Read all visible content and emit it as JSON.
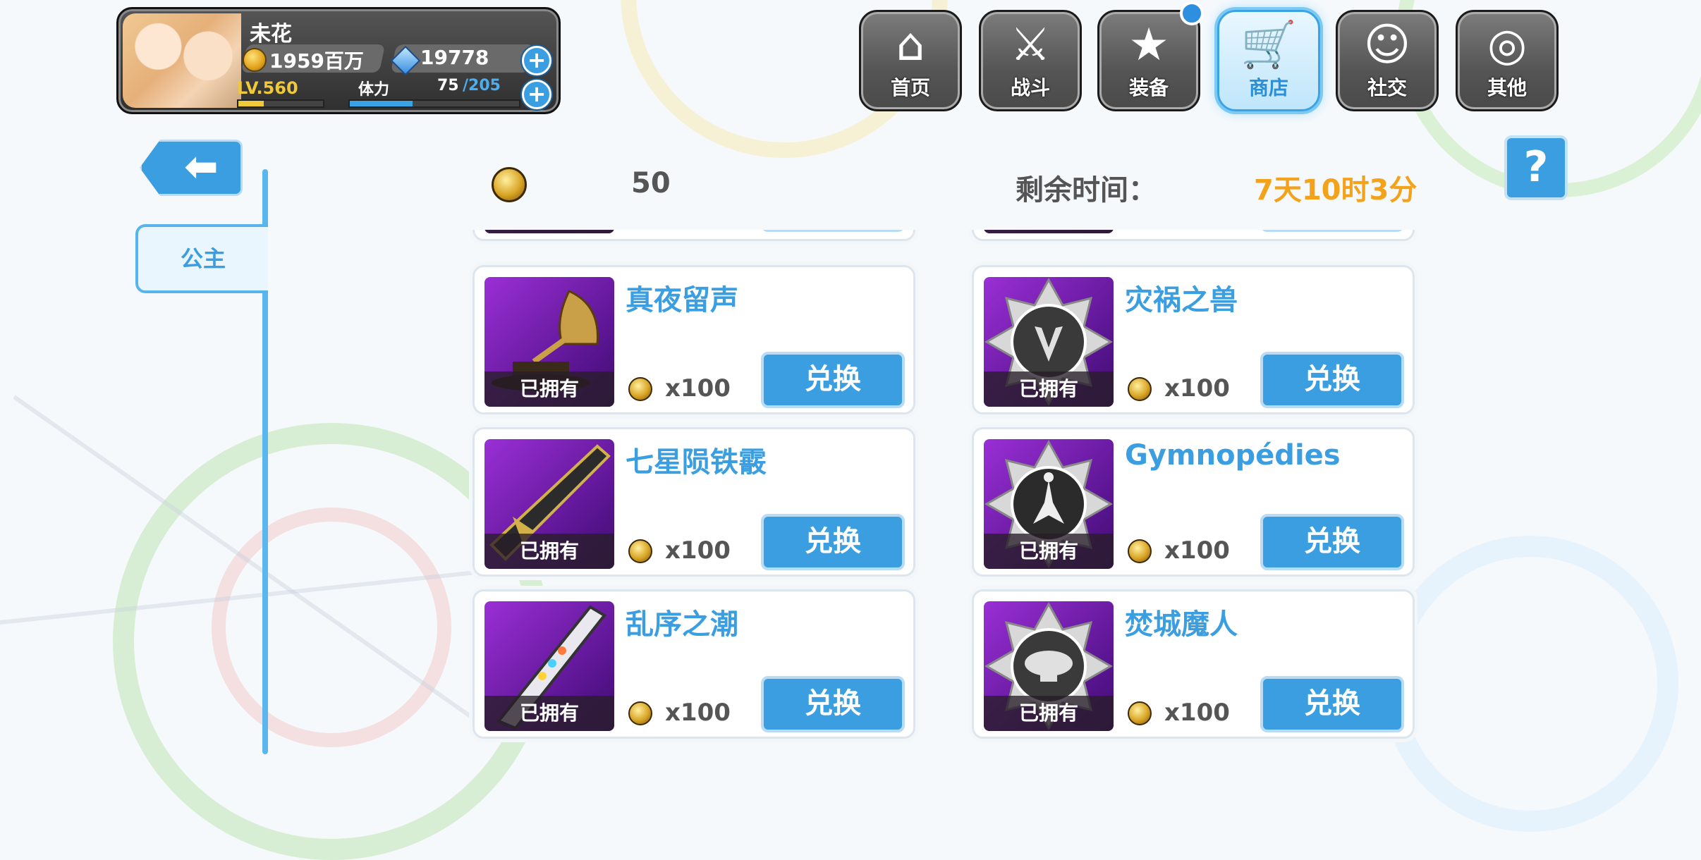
{
  "player": {
    "name": "未花",
    "gold": "1959百万",
    "gems": "19778",
    "level": "LV.560",
    "stamina_label": "体力",
    "stamina_current": "75",
    "stamina_max": "/205",
    "stamina_fraction": 0.37
  },
  "nav": [
    {
      "label": "首页",
      "icon": "home-icon"
    },
    {
      "label": "战斗",
      "icon": "battle-icon"
    },
    {
      "label": "装备",
      "icon": "equipment-icon"
    },
    {
      "label": "商店",
      "icon": "shop-icon",
      "active": true
    },
    {
      "label": "社交",
      "icon": "social-icon"
    },
    {
      "label": "其他",
      "icon": "other-icon"
    }
  ],
  "sidebar": {
    "tab": "公主"
  },
  "shop": {
    "token_count": "50",
    "time_label": "剩余时间：",
    "time_value": "7天10时3分",
    "owned_label": "已拥有",
    "price": "x100",
    "exchange_label": "兑换"
  },
  "items": [
    {
      "name": "真夜留声",
      "art": "gramophone"
    },
    {
      "name": "灾祸之兽",
      "art": "badge-beast"
    },
    {
      "name": "七星陨铁霰",
      "art": "gun"
    },
    {
      "name": "Gymnopédies",
      "art": "badge-dancer"
    },
    {
      "name": "乱序之潮",
      "art": "blade"
    },
    {
      "name": "焚城魔人",
      "art": "badge-airship"
    }
  ],
  "colors": {
    "accent": "#3a9ee0",
    "time": "#f2a21b",
    "thumb_purple": "#7a22b8"
  }
}
